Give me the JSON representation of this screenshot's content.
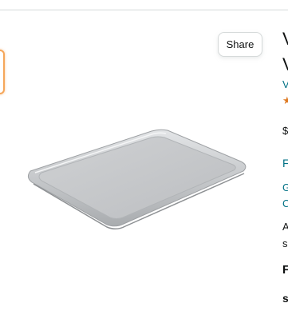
{
  "share_label": "Share",
  "product_title_lines": [
    "V",
    "V"
  ],
  "brand_link_fragment": "V",
  "rating_star_fragment": "★",
  "price_fragment": "$",
  "details_fragments": [
    "F",
    "G",
    "C",
    "A",
    "s",
    "F",
    "s"
  ],
  "image": {
    "subject": "aluminum sheet pan",
    "color": "#c6c8ca"
  },
  "colors": {
    "link": "#007185",
    "star": "#de7921",
    "selected_thumbnail_border": "#f5a65a"
  }
}
